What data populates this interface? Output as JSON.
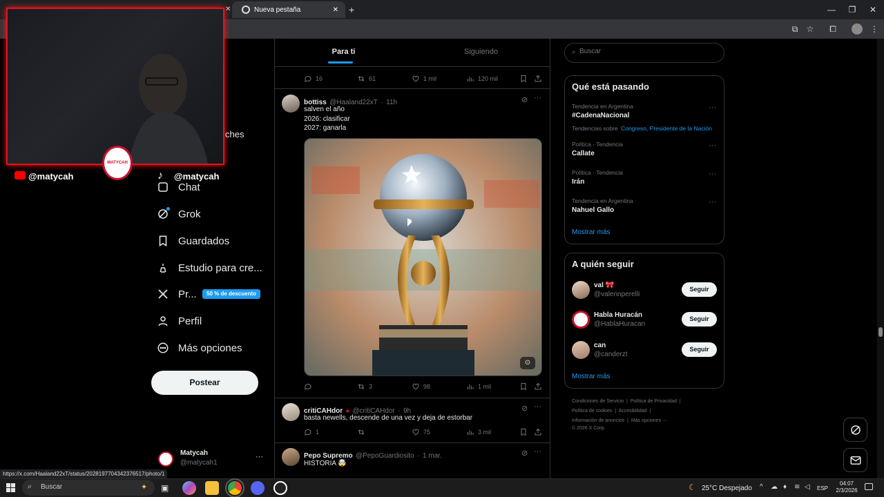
{
  "browser": {
    "tabs": [
      {
        "label": "Nueva pestaña"
      }
    ],
    "new_tab": "+",
    "win_min": "—",
    "win_max": "❐",
    "win_close": "✕"
  },
  "stream": {
    "youtube_handle": "@matycah",
    "tiktok_handle": "@matycah",
    "partial_text": "ches",
    "logo_text": "MATYCAH"
  },
  "nav": {
    "items": [
      {
        "label": "Chat",
        "icon": "chat-icon"
      },
      {
        "label": "Grok",
        "icon": "grok-icon"
      },
      {
        "label": "Guardados",
        "icon": "bookmark-icon"
      },
      {
        "label": "Estudio para cre...",
        "icon": "studio-icon"
      },
      {
        "label": "Pr...",
        "icon": "x-logo-icon"
      },
      {
        "label": "Perfil",
        "icon": "profile-icon"
      },
      {
        "label": "Más opciones",
        "icon": "more-circle-icon"
      }
    ],
    "premium_badge": "50 % de descuento",
    "post_button": "Postear",
    "account": {
      "name": "Matycah",
      "handle": "@matycah1",
      "more": "···"
    }
  },
  "feed": {
    "tabs": [
      {
        "label": "Para ti"
      },
      {
        "label": "Siguiendo"
      }
    ],
    "top_actions": {
      "replies": "16",
      "reposts": "61",
      "likes": "1 mil",
      "views": "120 mil"
    },
    "posts": [
      {
        "name": "bottiss",
        "handle": "@Haaland22xT",
        "time": "11h",
        "lines": [
          "salven el año",
          "2026: clasificar",
          "2027: ganarla"
        ],
        "actions": {
          "replies": "",
          "reposts": "3",
          "likes": "98",
          "views": "1 mil"
        }
      },
      {
        "name": "critiCAHdor",
        "handle": "@critiCAHdor",
        "time": "9h",
        "lines": [
          "basta newells, descende de una vez y deja de estorbar"
        ],
        "actions": {
          "replies": "1",
          "reposts": "",
          "likes": "75",
          "views": "3 mil"
        }
      },
      {
        "name": "Pepo Supremo",
        "handle": "@PepoGuardiosito",
        "time": "1 mar.",
        "lines": [
          "HISTORIA 🤯"
        ]
      }
    ],
    "separator": "·",
    "more": "···"
  },
  "right": {
    "search_placeholder": "Buscar",
    "trends_title": "Qué está pasando",
    "trends": [
      {
        "context": "Tendencia en Argentina",
        "name": "#CadenaNacional",
        "about_prefix": "Tendencias sobre",
        "about_links": "Congreso, Presidente de la Nación"
      },
      {
        "context": "Política · Tendencia",
        "name": "Callate"
      },
      {
        "context": "Política · Tendencia",
        "name": "Irán"
      },
      {
        "context": "Tendencia en Argentina",
        "name": "Nahuel Gallo"
      }
    ],
    "show_more": "Mostrar más",
    "follow_title": "A quién seguir",
    "follow": [
      {
        "name": "val 🎀",
        "handle": "@valennperelli",
        "button": "Seguir"
      },
      {
        "name": "Habla Huracán",
        "handle": "@HablaHuracan",
        "button": "Seguir"
      },
      {
        "name": "can",
        "handle": "@canderzt",
        "button": "Seguir"
      }
    ],
    "follow_show_more": "Mostrar más",
    "footer": {
      "line1": [
        "Condiciones de Servicio",
        "Política de Privacidad"
      ],
      "line2": [
        "Política de cookies",
        "Accesibilidad"
      ],
      "line3": [
        "Información de anuncios",
        "Más opciones ···"
      ],
      "copyright": "© 2026 X Corp."
    }
  },
  "status_url": "https://x.com/Haaland22xT/status/2028197704342376517/photo/1",
  "taskbar": {
    "search": "Buscar",
    "weather": "25°C  Despejado",
    "lang": "ESP",
    "time": "04:07",
    "date": "2/3/2026"
  },
  "colors": {
    "accent": "#1d9bf0",
    "stream_frame": "#e0141e",
    "background": "#000000"
  }
}
